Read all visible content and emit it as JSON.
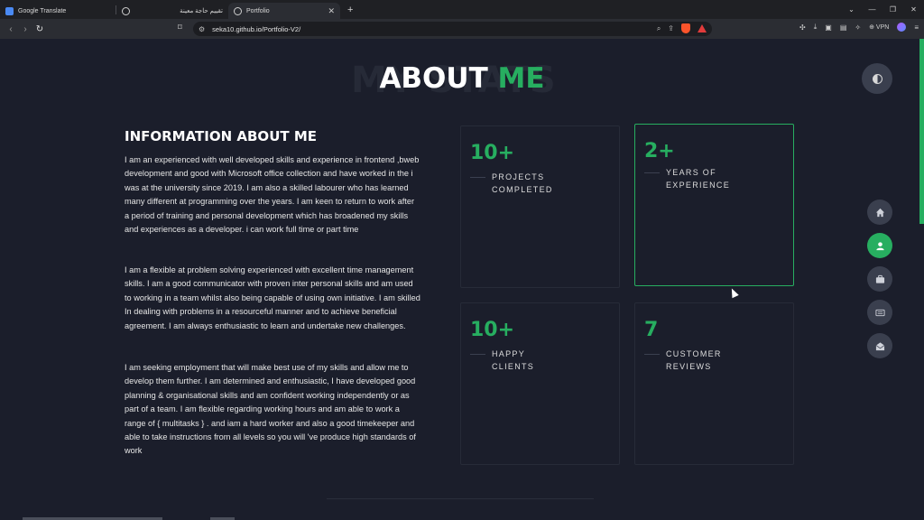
{
  "browser": {
    "tabs": [
      {
        "label": "Google Translate",
        "icon": "translate-icon"
      },
      {
        "label": "تقييم حاجة معينة",
        "icon": "brave-search-icon"
      },
      {
        "label": "Portfolio",
        "icon": "globe-icon",
        "active": true
      }
    ],
    "url": "seka10.github.io/Portfolio-V2/",
    "vpn_label": "VPN"
  },
  "page": {
    "bg_title": "MY STATS",
    "title_white": "ABOUT",
    "title_green": "ME",
    "info_title": "INFORMATION ABOUT ME",
    "paragraphs": [
      "I am an experienced with well developed skills and experience in frontend ,bweb development and good with Microsoft office collection and have worked in the i was at the university since 2019. I am also a skilled labourer who has learned many different at programming over the years. I am keen to return to work after a period of training and personal development which has broadened my skills and experiences as a developer. i can work full time or part time",
      "I am a flexible at problem solving experienced with excellent time management skills. I am a good communicator with proven inter personal skills and am used to working in a team whilst also being capable of using own initiative. I am skilled In dealing with problems in a resourceful manner and to achieve beneficial agreement. I am always enthusiastic to learn and undertake new challenges.",
      "I am seeking employment that will make best use of my skills and allow me to develop them further. I am determined and enthusiastic, I have developed good planning & organisational skills and am confident working independently or as part of a team. I am flexible regarding working hours and am able to work a range of { multitasks } . and iam a hard worker and also a good timekeeper and able to take instructions from all levels so you will 've produce high standards of work"
    ],
    "stats": [
      {
        "number": "10+",
        "line1": "PROJECTS",
        "line2": "COMPLETED"
      },
      {
        "number": "2+",
        "line1": "YEARS OF",
        "line2": "EXPERIENCE"
      },
      {
        "number": "10+",
        "line1": "HAPPY",
        "line2": "CLIENTS"
      },
      {
        "number": "7",
        "line1": "CUSTOMER",
        "line2": "REVIEWS"
      }
    ],
    "accent_color": "#27ae60",
    "nav_icons": [
      "home-icon",
      "user-icon",
      "briefcase-icon",
      "newspaper-icon",
      "envelope-open-icon"
    ]
  }
}
